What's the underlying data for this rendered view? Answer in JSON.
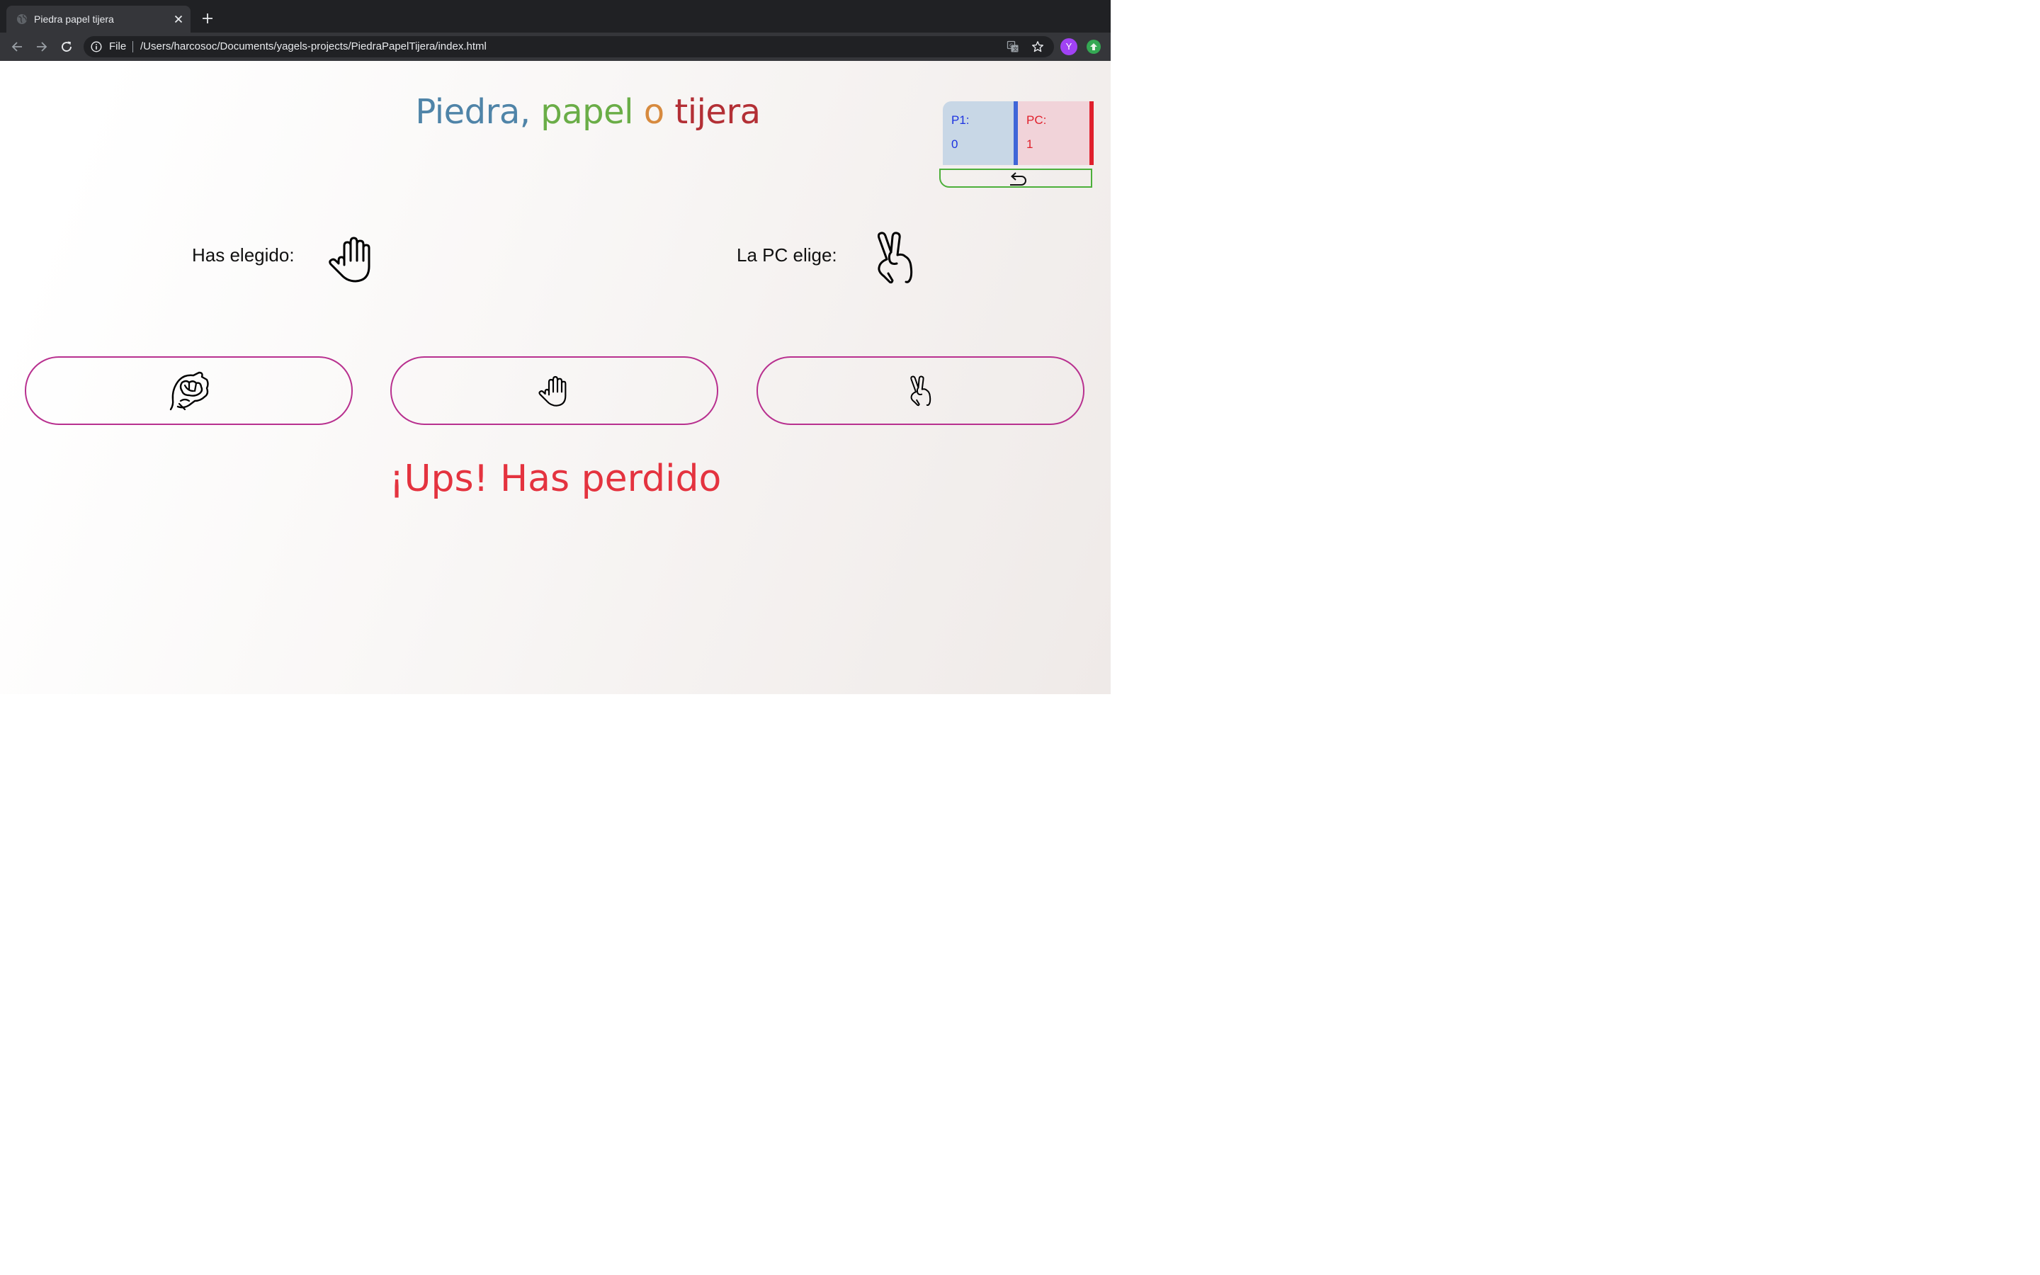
{
  "browser": {
    "tab_title": "Piedra papel tijera",
    "url_scheme": "File",
    "url": "/Users/harcosoc/Documents/yagels-projects/PiedraPapelTijera/index.html",
    "avatar_initial": "Y"
  },
  "game": {
    "title_words": [
      "Piedra,",
      "papel",
      "o",
      "tijera"
    ],
    "title_colors": [
      "#4f84a8",
      "#6aad47",
      "#d78a3e",
      "#b32f35"
    ],
    "score": {
      "p1_label": "P1:",
      "p1_value": "0",
      "pc_label": "PC:",
      "pc_value": "1"
    },
    "reset_icon": "return-arrow-icon",
    "you_chose_label": "Has elegido:",
    "you_chose_icon": "hand-paper-icon",
    "pc_chose_label": "La PC elige:",
    "pc_chose_icon": "hand-scissors-icon",
    "options": [
      {
        "name": "rock",
        "icon": "hand-rock-icon"
      },
      {
        "name": "paper",
        "icon": "hand-paper-icon"
      },
      {
        "name": "scissors",
        "icon": "hand-scissors-icon"
      }
    ],
    "result": "¡Ups! Has perdido",
    "colors": {
      "button_border": "#b8308f",
      "result": "#e4333f",
      "p1": "#1c32e0",
      "pc": "#e0202c",
      "reset_border": "#4caf3a"
    }
  }
}
